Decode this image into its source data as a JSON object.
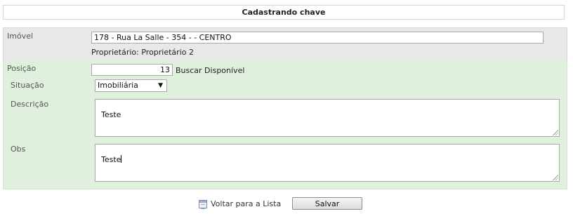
{
  "header": {
    "title": "Cadastrando chave"
  },
  "form": {
    "imovel": {
      "label": "Imóvel",
      "value": "178 - Rua La Salle - 354 -  - CENTRO"
    },
    "proprietario": {
      "text": "Proprietário: Proprietário 2"
    },
    "posicao": {
      "label": "Posição",
      "value": "13",
      "search_link": "Buscar Disponível"
    },
    "situacao": {
      "label": "Situação",
      "selected": "Imobiliária"
    },
    "descricao": {
      "label": "Descrição",
      "value": "Teste"
    },
    "obs": {
      "label": "Obs",
      "value": "Teste"
    }
  },
  "footer": {
    "back_link": "Voltar para a Lista",
    "save_label": "Salvar"
  },
  "icons": {
    "arrow": "▼",
    "list": "list-icon"
  },
  "colors": {
    "grey_section": "#e8e8e8",
    "green_section": "#dff1dc"
  }
}
